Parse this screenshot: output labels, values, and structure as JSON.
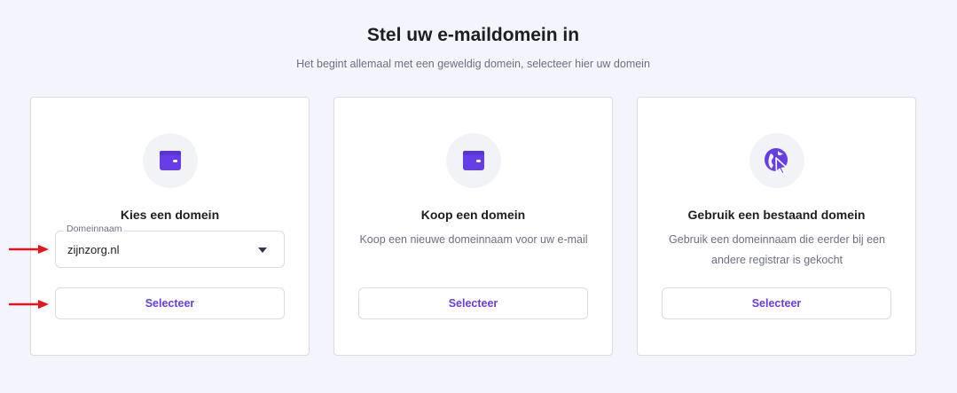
{
  "header": {
    "title": "Stel uw e-maildomein in",
    "subtitle": "Het begint allemaal met een geweldig domein, selecteer hier uw domein"
  },
  "cards": [
    {
      "icon": "wallet-icon",
      "title": "Kies een domein",
      "select": {
        "label": "Domeinnaam",
        "value": "zijnzorg.nl"
      },
      "button_label": "Selecteer"
    },
    {
      "icon": "wallet-icon",
      "title": "Koop een domein",
      "description": "Koop een nieuwe domeinnaam voor uw e-mail",
      "button_label": "Selecteer"
    },
    {
      "icon": "globe-cursor-icon",
      "title": "Gebruik een bestaand domein",
      "description": "Gebruik een domeinnaam die eerder bij een andere registrar is gekocht",
      "button_label": "Selecteer"
    }
  ],
  "colors": {
    "background": "#f4f4fd",
    "accent": "#673de6",
    "annotation_arrow": "#e8141c"
  }
}
